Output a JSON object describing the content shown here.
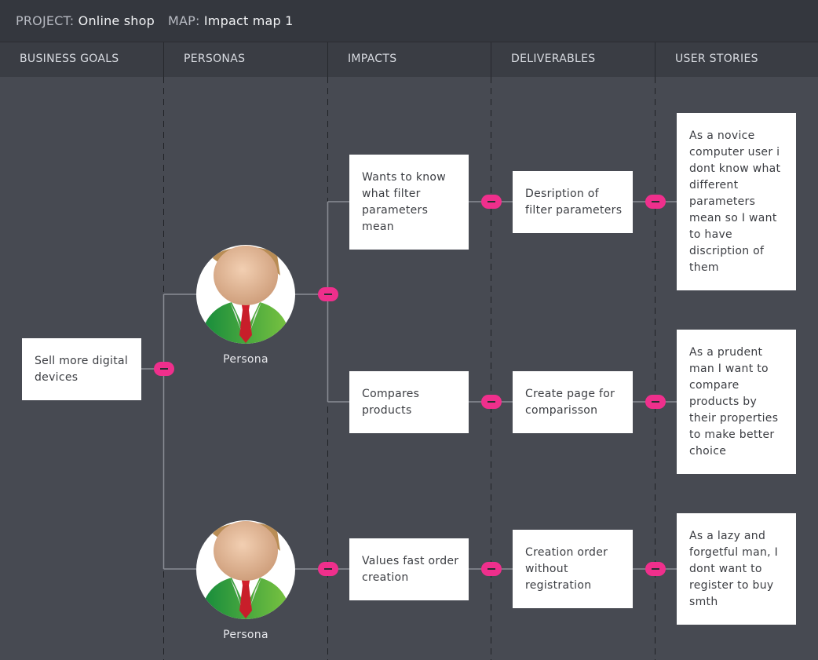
{
  "header": {
    "project_label": "PROJECT:",
    "project_name": "Online shop",
    "map_label": "MAP:",
    "map_name": "Impact map 1"
  },
  "columns": [
    "BUSINESS GOALS",
    "PERSONAS",
    "IMPACTS",
    "DELIVERABLES",
    "USER STORIES"
  ],
  "goals": [
    {
      "text": "Sell more digital devices"
    }
  ],
  "personas": [
    {
      "label": "Persona",
      "icon": "persona-avatar-icon"
    },
    {
      "label": "Persona",
      "icon": "persona-avatar-icon"
    }
  ],
  "impacts": [
    {
      "text": "Wants to know what filter parameters mean"
    },
    {
      "text": "Compares products"
    },
    {
      "text": "Values fast order creation"
    }
  ],
  "deliverables": [
    {
      "text": "Desription of filter parameters"
    },
    {
      "text": "Create page for comparisson"
    },
    {
      "text": "Creation order without registration"
    }
  ],
  "stories": [
    {
      "text": "As a novice computer user i dont know what different parameters mean so I want to have discription of them"
    },
    {
      "text": "As a prudent man I  want to compare products by their properties to make better choice"
    },
    {
      "text": "As a lazy and forgetful man, I dont want to register to buy smth"
    }
  ],
  "colors": {
    "background": "#474a52",
    "topbar": "#34373e",
    "toggle": "#ef2f8c",
    "card": "#ffffff"
  }
}
